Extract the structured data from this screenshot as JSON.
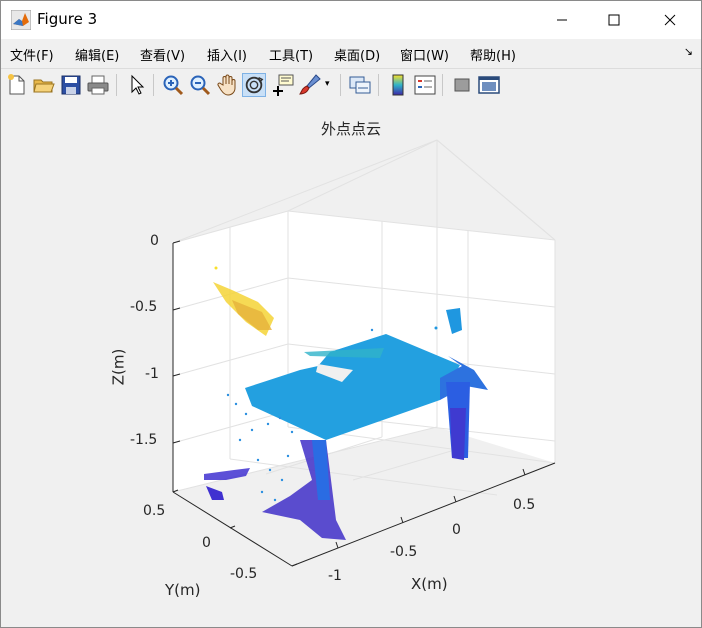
{
  "window": {
    "title": "Figure 3",
    "controls": {
      "minimize": "minimize",
      "maximize": "maximize",
      "close": "close"
    }
  },
  "menu": [
    {
      "label": "文件(F)"
    },
    {
      "label": "编辑(E)"
    },
    {
      "label": "查看(V)"
    },
    {
      "label": "插入(I)"
    },
    {
      "label": "工具(T)"
    },
    {
      "label": "桌面(D)"
    },
    {
      "label": "窗口(W)"
    },
    {
      "label": "帮助(H)"
    }
  ],
  "toolbar": [
    {
      "icon": "new-figure-icon"
    },
    {
      "icon": "open-file-icon"
    },
    {
      "icon": "save-icon"
    },
    {
      "icon": "print-icon"
    },
    {
      "icon": "edit-plot-icon"
    },
    {
      "icon": "zoom-in-icon"
    },
    {
      "icon": "zoom-out-icon"
    },
    {
      "icon": "pan-icon"
    },
    {
      "icon": "rotate-3d-icon",
      "active": true
    },
    {
      "icon": "data-cursor-icon"
    },
    {
      "icon": "brush-icon"
    },
    {
      "icon": "link-plot-icon"
    },
    {
      "icon": "colorbar-icon"
    },
    {
      "icon": "legend-icon"
    },
    {
      "icon": "hide-plot-tools-icon"
    },
    {
      "icon": "show-plot-tools-icon"
    }
  ],
  "plot": {
    "title": "外点点云",
    "z_label": "Z(m)",
    "y_label": "Y(m)",
    "x_label": "X(m)",
    "z_ticks": [
      "0",
      "-0.5",
      "-1",
      "-1.5"
    ],
    "y_ticks": [
      "0.5",
      "0",
      "-0.5"
    ],
    "x_ticks": [
      "-1",
      "-0.5",
      "0",
      "0.5"
    ],
    "colormap": [
      "#3d26a8",
      "#2f58e2",
      "#1f97e0",
      "#2fb3c9",
      "#7cc271",
      "#d9ba3d",
      "#f8e02a"
    ]
  }
}
